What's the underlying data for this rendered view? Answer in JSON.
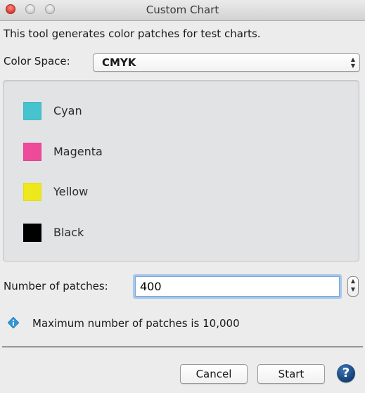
{
  "window": {
    "title": "Custom Chart",
    "controls": [
      "close",
      "minimize",
      "zoom"
    ]
  },
  "description": "This tool generates color patches for test charts.",
  "color_space": {
    "label": "Color Space:",
    "selected": "CMYK",
    "arrows_icon": "▲▼"
  },
  "inks": [
    {
      "name": "Cyan",
      "color": "#46c3cc"
    },
    {
      "name": "Magenta",
      "color": "#ee4a9a"
    },
    {
      "name": "Yellow",
      "color": "#ece81b"
    },
    {
      "name": "Black",
      "color": "#000000"
    }
  ],
  "patches": {
    "label": "Number of patches:",
    "value": "400",
    "stepper_icon": "▲▼"
  },
  "info": {
    "icon": "info-diamond-icon",
    "text": "Maximum number of patches is 10,000"
  },
  "buttons": {
    "cancel": "Cancel",
    "start": "Start",
    "help": "?"
  }
}
